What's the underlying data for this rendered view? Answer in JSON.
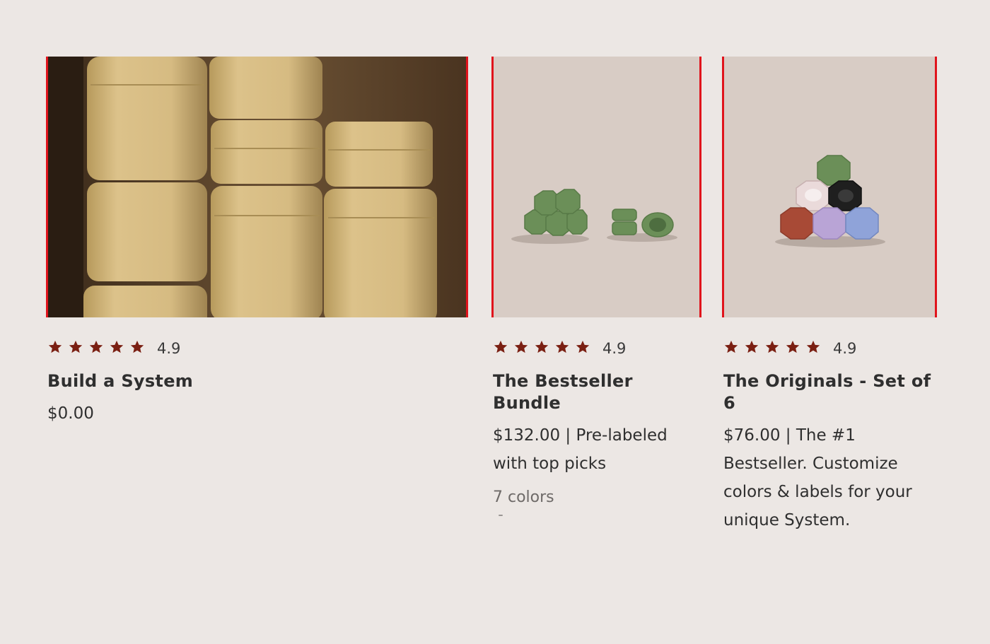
{
  "products": [
    {
      "rating": "4.9",
      "title": "Build a System",
      "price": "$0.00",
      "image_alt": "Stack of sand-colored pill containers"
    },
    {
      "rating": "4.9",
      "title": "The Bestseller Bundle",
      "price": "$132.00 | Pre-labeled with top picks",
      "colors": "7 colors",
      "image_alt": "Green hexagonal pill containers"
    },
    {
      "rating": "4.9",
      "title": "The Originals - Set of 6",
      "price": "$76.00 | The #1 Bestseller. Customize colors & labels for your unique System.",
      "image_alt": "Pyramid of multicolor hexagonal pill containers"
    }
  ],
  "rating_stars": 5,
  "colors": {
    "page_background": "#ece7e4",
    "star": "#7a1f12",
    "highlight_border": "#e0141c",
    "text": "#2f2f2f"
  }
}
